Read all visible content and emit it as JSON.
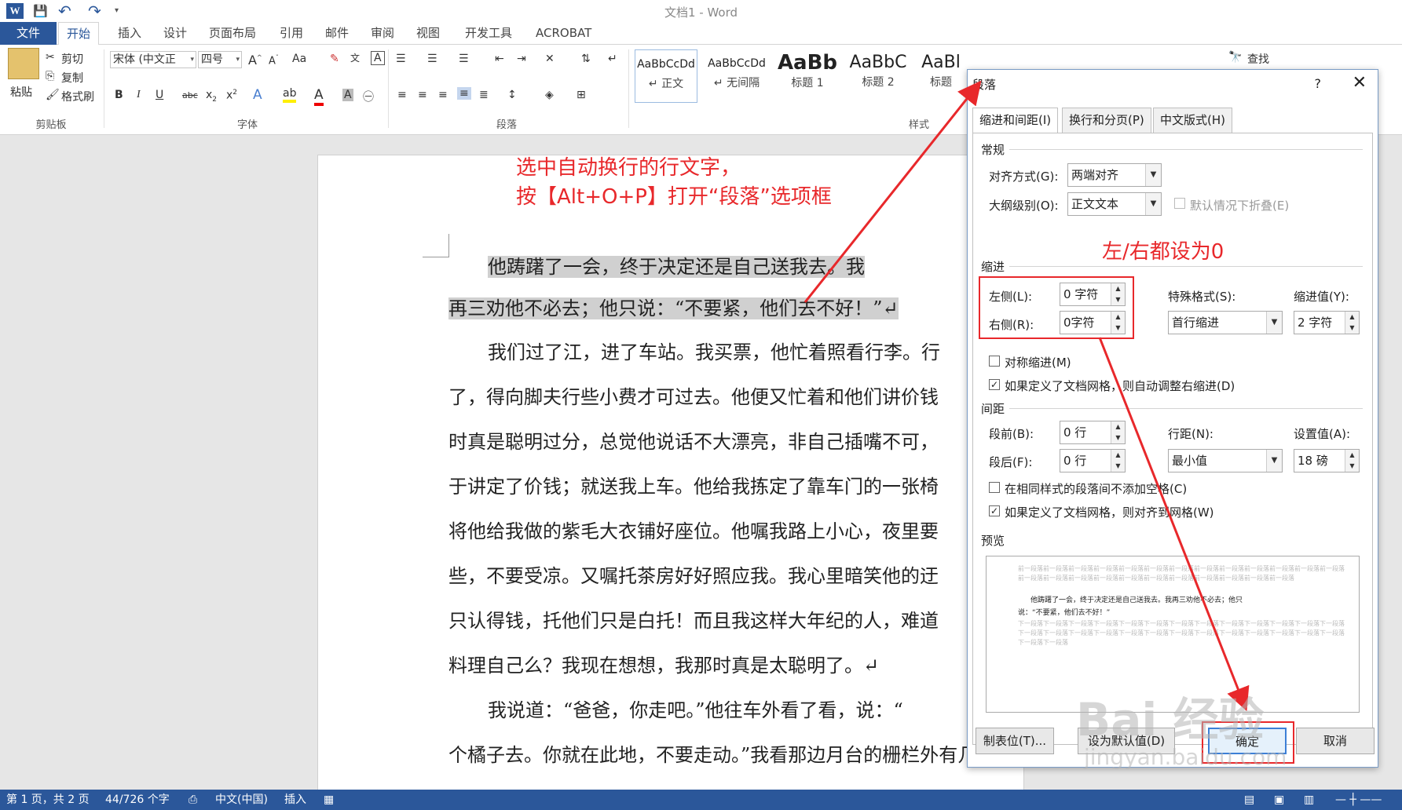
{
  "window": {
    "title": "文档1 - Word",
    "logo_letter": "W"
  },
  "qat": {
    "save": "💾",
    "undo": "↶",
    "redo": "↷"
  },
  "tabs": [
    "文件",
    "开始",
    "插入",
    "设计",
    "页面布局",
    "引用",
    "邮件",
    "审阅",
    "视图",
    "开发工具",
    "ACROBAT"
  ],
  "ribbon": {
    "clipboard": {
      "paste": "粘贴",
      "cut": "剪切",
      "copy": "复制",
      "format_painter": "格式刷",
      "label": "剪贴板"
    },
    "font": {
      "face": "宋体 (中文正",
      "size": "四号",
      "label": "字体",
      "change_case": "Aa"
    },
    "paragraph": {
      "label": "段落"
    },
    "styles": {
      "label": "样式",
      "items": [
        {
          "sample": "AaBbCcDd",
          "name": "↵ 正文"
        },
        {
          "sample": "AaBbCcDd",
          "name": "↵ 无间隔"
        },
        {
          "sample": "AaBb",
          "name": "标题 1"
        },
        {
          "sample": "AaBbC",
          "name": "标题 2"
        },
        {
          "sample": "AaBl",
          "name": "标题"
        }
      ]
    },
    "editing": {
      "find": "查找"
    }
  },
  "document": {
    "lines": [
      "他踌躇了一会，终于决定还是自己送我去。我",
      "再三劝他不必去；他只说：“不要紧，他们去不好！”↵",
      "我们过了江，进了车站。我买票，他忙着照看行李。行",
      "了，得向脚夫行些小费才可过去。他便又忙着和他们讲价钱",
      "时真是聪明过分，总觉他说话不大漂亮，非自己插嘴不可，",
      "于讲定了价钱；就送我上车。他给我拣定了靠车门的一张椅",
      "将他给我做的紫毛大衣铺好座位。他嘱我路上小心，夜里要",
      "些，不要受凉。又嘱托茶房好好照应我。我心里暗笑他的迂",
      "只认得钱，托他们只是白托！而且我这样大年纪的人，难道",
      "料理自己么？我现在想想，我那时真是太聪明了。↵",
      "我说道：“爸爸，你走吧。”他往车外看了看，说：“",
      "个橘子去。你就在此地，不要走动。”我看那边月台的栅栏外有几"
    ]
  },
  "annotations": {
    "line1": "选中自动换行的行文字，",
    "line2": "按【Alt+O+P】打开“段落”选项框",
    "indent_note": "左/右都设为0"
  },
  "status": {
    "page": "第 1 页，共 2 页",
    "words": "44/726 个字",
    "language": "中文(中国)",
    "mode": "插入"
  },
  "dialog": {
    "title": "段落",
    "help": "?",
    "close": "✕",
    "tabs": [
      "缩进和间距(I)",
      "换行和分页(P)",
      "中文版式(H)"
    ],
    "general": {
      "title": "常规",
      "alignment_label": "对齐方式(G):",
      "alignment_value": "两端对齐",
      "outline_label": "大纲级别(O):",
      "outline_value": "正文文本",
      "collapse_label": "默认情况下折叠(E)"
    },
    "indent": {
      "title": "缩进",
      "left_label": "左侧(L):",
      "left_value": "0 字符",
      "right_label": "右侧(R):",
      "right_value": "0字符",
      "special_label": "特殊格式(S):",
      "special_value": "首行缩进",
      "by_label": "缩进值(Y):",
      "by_value": "2 字符",
      "mirror_label": "对称缩进(M)",
      "auto_adjust_label": "如果定义了文档网格，则自动调整右缩进(D)",
      "auto_adjust_checked": true
    },
    "spacing": {
      "title": "间距",
      "before_label": "段前(B):",
      "before_value": "0 行",
      "after_label": "段后(F):",
      "after_value": "0 行",
      "line_label": "行距(N):",
      "line_value": "最小值",
      "at_label": "设置值(A):",
      "at_value": "18 磅",
      "no_space_label": "在相同样式的段落间不添加空格(C)",
      "snap_label": "如果定义了文档网格，则对齐到网格(W)",
      "snap_checked": true
    },
    "preview": {
      "title": "预览",
      "prev_text": "前一段落前一段落前一段落前一段落前一段落前一段落前一段落前一段落前一段落前一段落前一段落前一段落前一段落前一段落前一段落前一段落前一段落前一段落前一段落前一段落前一段落前一段落前一段落前一段落",
      "sample_line1": "他踌躇了一会，终于决定还是自己送我去。我再三劝他不必去；他只",
      "sample_line2": "说：“不要紧，他们去不好！”",
      "next_text": "下一段落下一段落下一段落下一段落下一段落下一段落下一段落下一段落下一段落下一段落下一段落下一段落下一段落下一段落下一段落下一段落下一段落下一段落下一段落下一段落下一段落下一段落下一段落下一段落下一段落下一段落下一段落下一段落"
    },
    "buttons": {
      "tabs": "制表位(T)...",
      "set_default": "设为默认值(D)",
      "ok": "确定",
      "cancel": "取消"
    }
  },
  "watermark": {
    "brand": "Bai 经验",
    "url": "jingyan.baidu.com"
  },
  "colors": {
    "accent": "#2b579a",
    "annotation": "#e8282b"
  }
}
